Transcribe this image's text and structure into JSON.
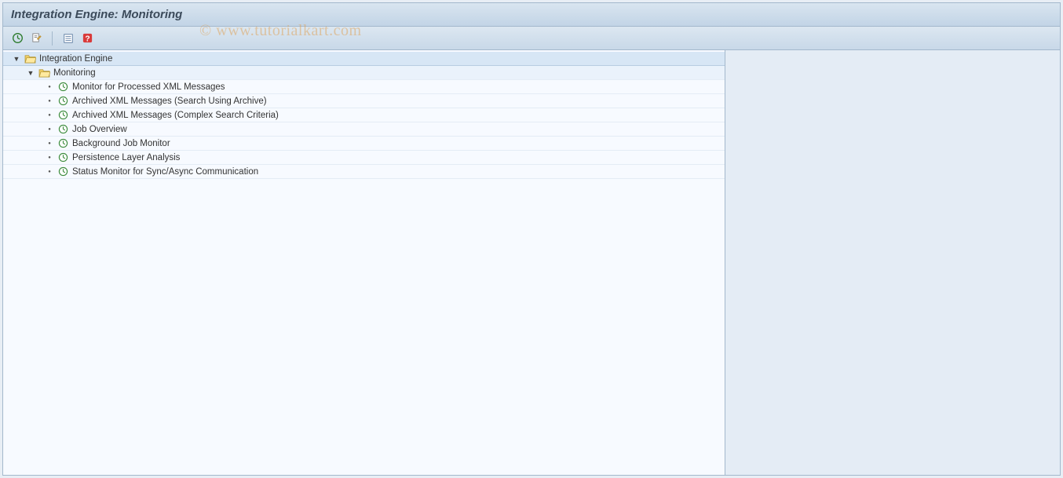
{
  "window": {
    "title": "Integration Engine: Monitoring"
  },
  "toolbar": {
    "execute": "execute",
    "edit": "edit",
    "details": "details",
    "help": "help"
  },
  "watermark": "© www.tutorialkart.com",
  "tree": {
    "root": {
      "label": "Integration Engine",
      "expanded": true,
      "child": {
        "label": "Monitoring",
        "expanded": true,
        "items": [
          {
            "label": "Monitor for Processed XML Messages"
          },
          {
            "label": "Archived XML Messages (Search Using Archive)"
          },
          {
            "label": "Archived XML Messages (Complex Search Criteria)"
          },
          {
            "label": "Job Overview"
          },
          {
            "label": "Background Job Monitor"
          },
          {
            "label": "Persistence Layer Analysis"
          },
          {
            "label": "Status Monitor for Sync/Async Communication"
          }
        ]
      }
    }
  }
}
